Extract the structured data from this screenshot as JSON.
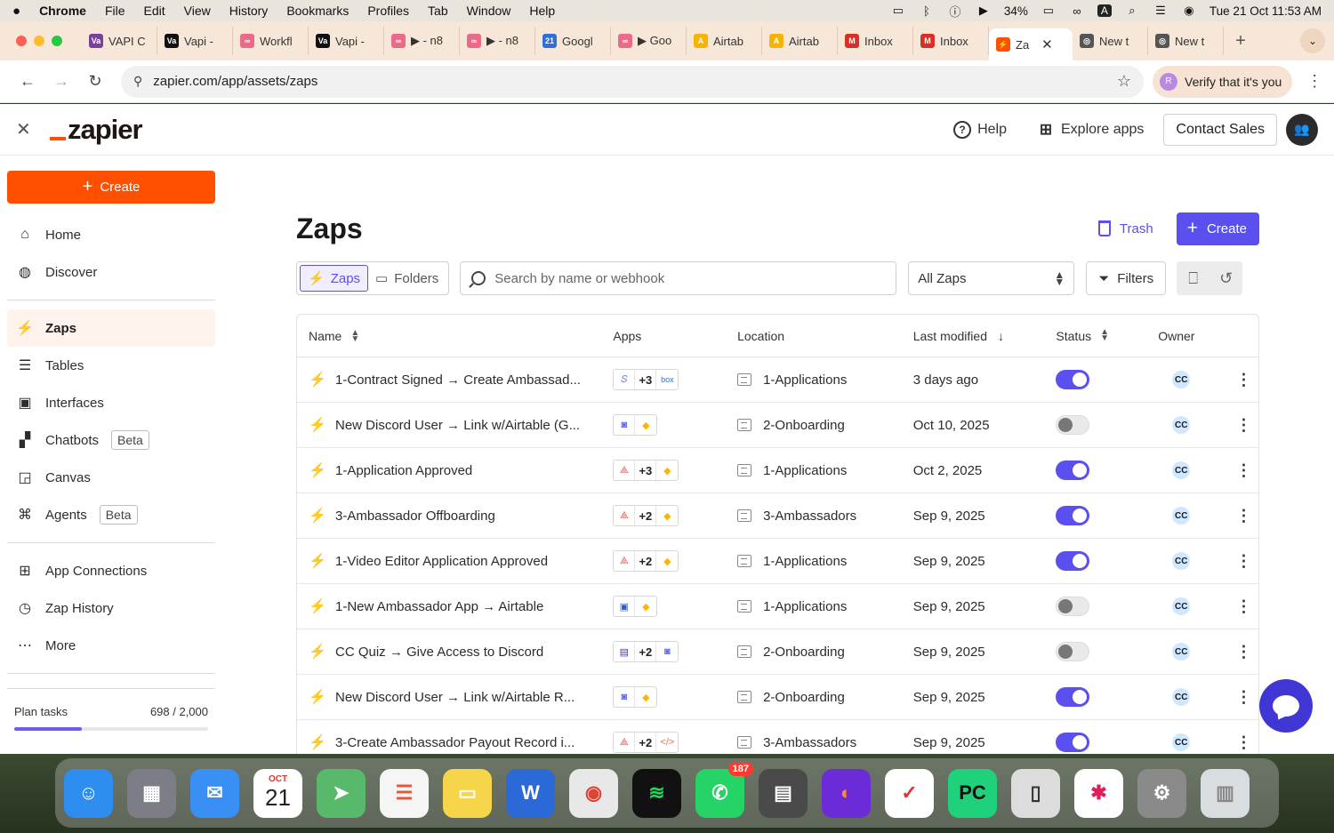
{
  "menubar": {
    "apple": "",
    "items": [
      "Chrome",
      "File",
      "Edit",
      "View",
      "History",
      "Bookmarks",
      "Profiles",
      "Tab",
      "Window",
      "Help"
    ],
    "battery": "34%",
    "input_source": "A",
    "datetime": "Tue 21 Oct  11:53 AM"
  },
  "tabs": [
    {
      "label": "VAPI C",
      "fav": "Va",
      "color": "#7b3fa0"
    },
    {
      "label": "Vapi -",
      "fav": "Va",
      "color": "#111111"
    },
    {
      "label": "Workfl",
      "fav": "∞",
      "color": "#ea6a8a"
    },
    {
      "label": "Vapi -",
      "fav": "Va",
      "color": "#111111"
    },
    {
      "label": "▶ - n8",
      "fav": "∞",
      "color": "#ea6a8a"
    },
    {
      "label": "▶ - n8",
      "fav": "∞",
      "color": "#ea6a8a"
    },
    {
      "label": "Googl",
      "fav": "21",
      "color": "#2f6fd8"
    },
    {
      "label": "▶ Goo",
      "fav": "∞",
      "color": "#ea6a8a"
    },
    {
      "label": "Airtab",
      "fav": "A",
      "color": "#f6b400"
    },
    {
      "label": "Airtab",
      "fav": "A",
      "color": "#f6b400"
    },
    {
      "label": "Inbox",
      "fav": "M",
      "color": "#d93025"
    },
    {
      "label": "Inbox",
      "fav": "M",
      "color": "#d93025"
    },
    {
      "label": "Za",
      "fav": "⚡",
      "color": "#ff4f00",
      "active": true
    },
    {
      "label": "New t",
      "fav": "◎",
      "color": "#555555"
    },
    {
      "label": "New t",
      "fav": "◎",
      "color": "#555555"
    }
  ],
  "urlbar": {
    "url": "zapier.com/app/assets/zaps",
    "verify_label": "Verify that it's you",
    "verify_avatar": "R"
  },
  "topnav": {
    "logo": "zapier",
    "help": "Help",
    "explore": "Explore apps",
    "contact": "Contact Sales"
  },
  "sidebar": {
    "create": "Create",
    "items": [
      {
        "label": "Home",
        "icon": "⌂"
      },
      {
        "label": "Discover",
        "icon": "◍"
      }
    ],
    "items2": [
      {
        "label": "Zaps",
        "icon": "⚡",
        "active": true
      },
      {
        "label": "Tables",
        "icon": "☰"
      },
      {
        "label": "Interfaces",
        "icon": "▣"
      },
      {
        "label": "Chatbots",
        "icon": "▞",
        "badge": "Beta"
      },
      {
        "label": "Canvas",
        "icon": "◲"
      },
      {
        "label": "Agents",
        "icon": "⌘",
        "badge": "Beta"
      }
    ],
    "items3": [
      {
        "label": "App Connections",
        "icon": "⊞"
      },
      {
        "label": "Zap History",
        "icon": "◷"
      },
      {
        "label": "More",
        "icon": "⋯"
      }
    ],
    "plan_label": "Plan tasks",
    "plan_value": "698 / 2,000",
    "plan_fraction": 0.349
  },
  "main": {
    "title": "Zaps",
    "trash": "Trash",
    "create": "Create",
    "seg_zaps": "Zaps",
    "seg_folders": "Folders",
    "search_placeholder": "Search by name or webhook",
    "filter_select": "All Zaps",
    "filters": "Filters"
  },
  "table": {
    "headers": {
      "name": "Name",
      "apps": "Apps",
      "location": "Location",
      "modified": "Last modified",
      "status": "Status",
      "owner": "Owner"
    },
    "rows": [
      {
        "name": "1-Contract Signed → Create Ambassad...",
        "apps": [
          "S",
          "+3",
          "box"
        ],
        "location": "1-Applications",
        "modified": "3 days ago",
        "on": true,
        "owner": "CC"
      },
      {
        "name": "New Discord User → Link w/Airtable (G...",
        "apps": [
          "D",
          "A"
        ],
        "location": "2-Onboarding",
        "modified": "Oct 10, 2025",
        "on": false,
        "owner": "CC"
      },
      {
        "name": "1-Application Approved",
        "apps": [
          "Ac",
          "+3",
          "A"
        ],
        "location": "1-Applications",
        "modified": "Oct 2, 2025",
        "on": true,
        "owner": "CC"
      },
      {
        "name": "3-Ambassador Offboarding",
        "apps": [
          "Ac",
          "+2",
          "A"
        ],
        "location": "3-Ambassadors",
        "modified": "Sep 9, 2025",
        "on": true,
        "owner": "CC"
      },
      {
        "name": "1-Video Editor Application Approved",
        "apps": [
          "Ac",
          "+2",
          "A"
        ],
        "location": "1-Applications",
        "modified": "Sep 9, 2025",
        "on": true,
        "owner": "CC"
      },
      {
        "name": "1-New Ambassador App → Airtable",
        "apps": [
          "W",
          "A"
        ],
        "location": "1-Applications",
        "modified": "Sep 9, 2025",
        "on": false,
        "owner": "CC"
      },
      {
        "name": "CC Quiz → Give Access to Discord",
        "apps": [
          "F",
          "+2",
          "D"
        ],
        "location": "2-Onboarding",
        "modified": "Sep 9, 2025",
        "on": false,
        "owner": "CC"
      },
      {
        "name": "New Discord User → Link w/Airtable R...",
        "apps": [
          "D",
          "A"
        ],
        "location": "2-Onboarding",
        "modified": "Sep 9, 2025",
        "on": true,
        "owner": "CC"
      },
      {
        "name": "3-Create Ambassador Payout Record i...",
        "apps": [
          "Ac",
          "+2",
          "</>"
        ],
        "location": "3-Ambassadors",
        "modified": "Sep 9, 2025",
        "on": true,
        "owner": "CC"
      }
    ]
  },
  "dock": [
    {
      "name": "finder",
      "glyph": "☺",
      "bg": "#2d8ef0"
    },
    {
      "name": "launchpad",
      "glyph": "▦",
      "bg": "#7d7d88"
    },
    {
      "name": "mail",
      "glyph": "✉",
      "bg": "#3a8ff5"
    },
    {
      "name": "calendar",
      "glyph": "21",
      "bg": "#ffffff",
      "fg": "#222",
      "top": "OCT"
    },
    {
      "name": "maps",
      "glyph": "➤",
      "bg": "#58b96b"
    },
    {
      "name": "reminders",
      "glyph": "☰",
      "bg": "#f5f5f5",
      "fg": "#e8553d"
    },
    {
      "name": "notes",
      "glyph": "▭",
      "bg": "#f7d54a"
    },
    {
      "name": "word",
      "glyph": "W",
      "bg": "#2b68d8"
    },
    {
      "name": "chrome",
      "glyph": "◉",
      "bg": "#e8e8e8",
      "fg": "#db4437"
    },
    {
      "name": "spotify",
      "glyph": "≋",
      "bg": "#111111",
      "fg": "#1ed760"
    },
    {
      "name": "whatsapp",
      "glyph": "✆",
      "bg": "#25d366",
      "badge": "187"
    },
    {
      "name": "calculator",
      "glyph": "▤",
      "bg": "#4a4a4a"
    },
    {
      "name": "firefox",
      "glyph": "◐",
      "bg": "#6b2bd6",
      "fg": "#ff8a2b"
    },
    {
      "name": "ticktick",
      "glyph": "✓",
      "bg": "#ffffff",
      "fg": "#e0342e"
    },
    {
      "name": "pycharm",
      "glyph": "PC",
      "bg": "#1fd17a",
      "fg": "#111"
    },
    {
      "name": "iphone-mirroring",
      "glyph": "▯",
      "bg": "#dcdcdc",
      "fg": "#333"
    },
    {
      "name": "slack",
      "glyph": "✱",
      "bg": "#ffffff",
      "fg": "#e01e5a"
    },
    {
      "name": "system-settings",
      "glyph": "⚙",
      "bg": "#8a8a8a"
    },
    {
      "name": "trash",
      "glyph": "▥",
      "bg": "#d9dde0",
      "fg": "#888"
    }
  ]
}
